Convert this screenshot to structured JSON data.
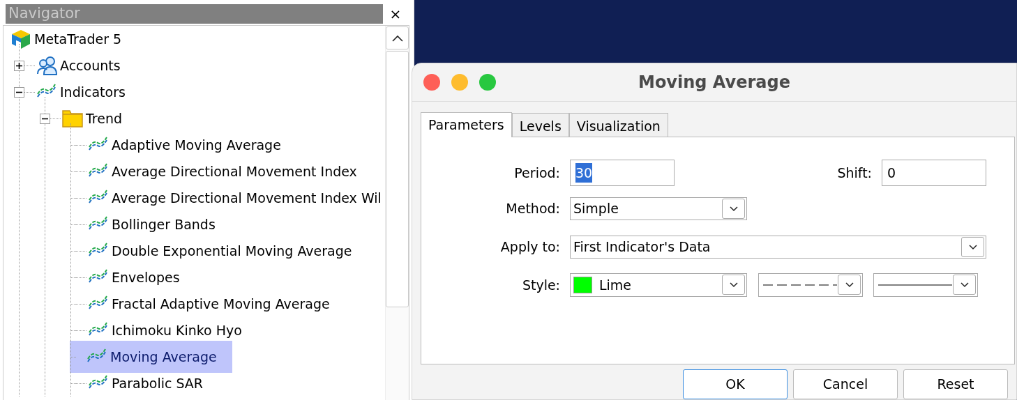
{
  "navigator": {
    "title": "Navigator",
    "close": "×",
    "tree": [
      {
        "label": "MetaTrader 5",
        "kind": "terminal",
        "selected": false,
        "children": [
          {
            "label": "Accounts",
            "kind": "accounts",
            "selected": false,
            "expanded": false
          },
          {
            "label": "Indicators",
            "kind": "indicator",
            "selected": false,
            "expanded": true,
            "children": [
              {
                "label": "Trend",
                "kind": "folder",
                "selected": false,
                "expanded": true,
                "children": [
                  {
                    "label": "Adaptive Moving Average",
                    "kind": "indicator",
                    "selected": false
                  },
                  {
                    "label": "Average Directional Movement Index",
                    "kind": "indicator",
                    "selected": false
                  },
                  {
                    "label": "Average Directional Movement Index Wil",
                    "kind": "indicator",
                    "selected": false
                  },
                  {
                    "label": "Bollinger Bands",
                    "kind": "indicator",
                    "selected": false
                  },
                  {
                    "label": "Double Exponential Moving Average",
                    "kind": "indicator",
                    "selected": false
                  },
                  {
                    "label": "Envelopes",
                    "kind": "indicator",
                    "selected": false
                  },
                  {
                    "label": "Fractal Adaptive Moving Average",
                    "kind": "indicator",
                    "selected": false
                  },
                  {
                    "label": "Ichimoku Kinko Hyo",
                    "kind": "indicator",
                    "selected": false
                  },
                  {
                    "label": "Moving Average",
                    "kind": "indicator",
                    "selected": true
                  },
                  {
                    "label": "Parabolic SAR",
                    "kind": "indicator",
                    "selected": false
                  }
                ]
              }
            ]
          }
        ]
      }
    ]
  },
  "dialog": {
    "title": "Moving Average",
    "tabs": [
      {
        "label": "Parameters",
        "selected": true
      },
      {
        "label": "Levels",
        "selected": false
      },
      {
        "label": "Visualization",
        "selected": false
      }
    ],
    "period": {
      "label": "Period:",
      "value": "30",
      "text_selected": true
    },
    "shift": {
      "label": "Shift:",
      "value": "0",
      "text_selected": false
    },
    "method": {
      "label": "Method:",
      "value": "Simple"
    },
    "apply_to": {
      "label": "Apply to:",
      "value": "First Indicator's Data"
    },
    "style": {
      "label": "Style:",
      "color": "#00ff00",
      "color_name": "Lime",
      "dashed": true
    },
    "buttons": [
      {
        "label": "OK",
        "default": true
      },
      {
        "label": "Cancel",
        "default": false
      },
      {
        "label": "Reset",
        "default": false
      }
    ]
  }
}
